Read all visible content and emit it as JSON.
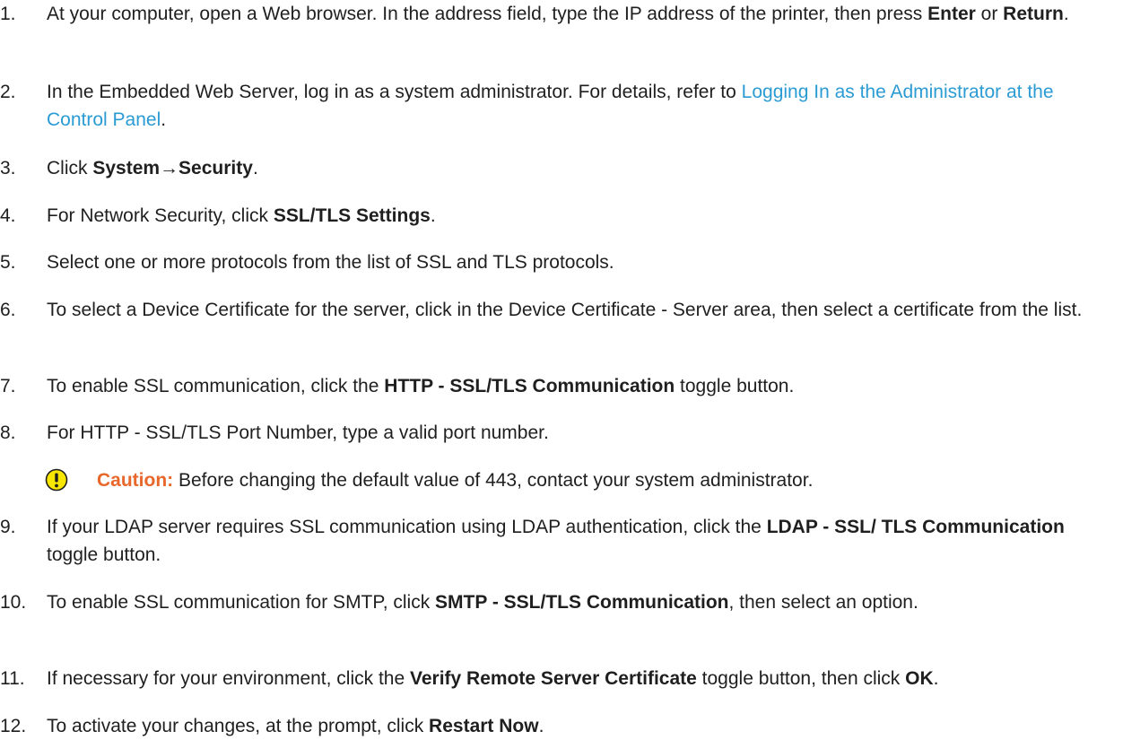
{
  "colors": {
    "link": "#2b9bd3",
    "caution_label": "#e8672b",
    "caution_icon_fill": "#f7e600",
    "caution_icon_stroke": "#1f1f1f"
  },
  "steps": [
    {
      "number": "1.",
      "t1": "At your computer, open a Web browser. In the address field, type the IP address of the printer, then press ",
      "b1": "Enter",
      "t2": " or ",
      "b2": "Return",
      "t3": "."
    },
    {
      "number": "2.",
      "t1": "In the Embedded Web Server, log in as a system administrator. For details, refer to ",
      "link": "Logging In as the Administrator at the Control Panel",
      "t2": "."
    },
    {
      "number": "3.",
      "t1": "Click ",
      "b1": "System→Security",
      "t2": "."
    },
    {
      "number": "4.",
      "t1": "For Network Security, click ",
      "b1": "SSL/TLS Settings",
      "t2": "."
    },
    {
      "number": "5.",
      "t1": "Select one or more protocols from the list of SSL and TLS protocols."
    },
    {
      "number": "6.",
      "t1": "To select a Device Certificate for the server, click in the Device Certificate - Server area, then select a certificate from the list."
    },
    {
      "number": "7.",
      "t1": "To enable SSL communication, click the ",
      "b1": "HTTP - SSL/TLS Communication",
      "t2": " toggle button."
    },
    {
      "number": "8.",
      "t1": "For HTTP - SSL/TLS Port Number, type a valid port number."
    },
    {
      "number": "9.",
      "t1": "If your LDAP server requires SSL communication using LDAP authentication, click the ",
      "b1": "LDAP - SSL/ TLS Communication",
      "t2": " toggle button."
    },
    {
      "number": "10.",
      "t1": "To enable SSL communication for SMTP, click ",
      "b1": "SMTP - SSL/TLS Communication",
      "t2": ", then select an option."
    },
    {
      "number": "11.",
      "t1": "If necessary for your environment, click the ",
      "b1": "Verify Remote Server Certificate",
      "t2": " toggle button, then click ",
      "b2": "OK",
      "t3": "."
    },
    {
      "number": "12.",
      "t1": "To activate your changes, at the prompt, click ",
      "b1": "Restart Now",
      "t2": "."
    }
  ],
  "caution": {
    "label": "Caution:",
    "text": " Before changing the default value of 443, contact your system administrator.",
    "icon": "caution-exclamation-icon"
  }
}
